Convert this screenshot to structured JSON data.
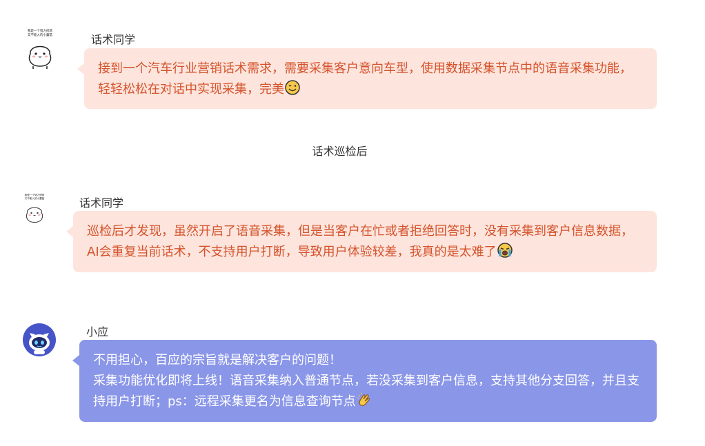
{
  "messages": [
    {
      "sender": "话术同学",
      "sticker_caption": [
        "我是一个努力修炼",
        "又不能入的小蘑菇"
      ],
      "text": "接到一个汽车行业营销话术需求，需要采集客户意向车型，使用数据采集节点中的语音采集功能，轻轻松松在对话中实现采集，完美",
      "emoji": "smile-emoji"
    },
    {
      "sender": "话术同学",
      "sticker_caption": [
        "我是一个努力修炼",
        "又不能入的小蘑菇"
      ],
      "text": "巡检后才发现，虽然开启了语音采集，但是当客户在忙或者拒绝回答时，没有采集到客户信息数据，AI会重复当前话术，不支持用户打断，导致用户体验较差，我真的是太难了",
      "emoji": "crying-emoji"
    },
    {
      "sender": "小应",
      "lines": [
        "不用担心，百应的宗旨就是解决客户的问题！",
        "采集功能优化即将上线！语音采集纳入普通节点，若没采集到客户信息，支持其他分支回答，并且支持用户打断；ps：远程采集更名为信息查询节点"
      ],
      "emoji": "clapping-hands-emoji"
    }
  ],
  "divider_text": "话术巡检后",
  "colors": {
    "pink_bubble": "#fde4dc",
    "pink_text": "#d4532c",
    "blue_bubble": "#8a96e8",
    "blue_text": "#ffffff"
  }
}
